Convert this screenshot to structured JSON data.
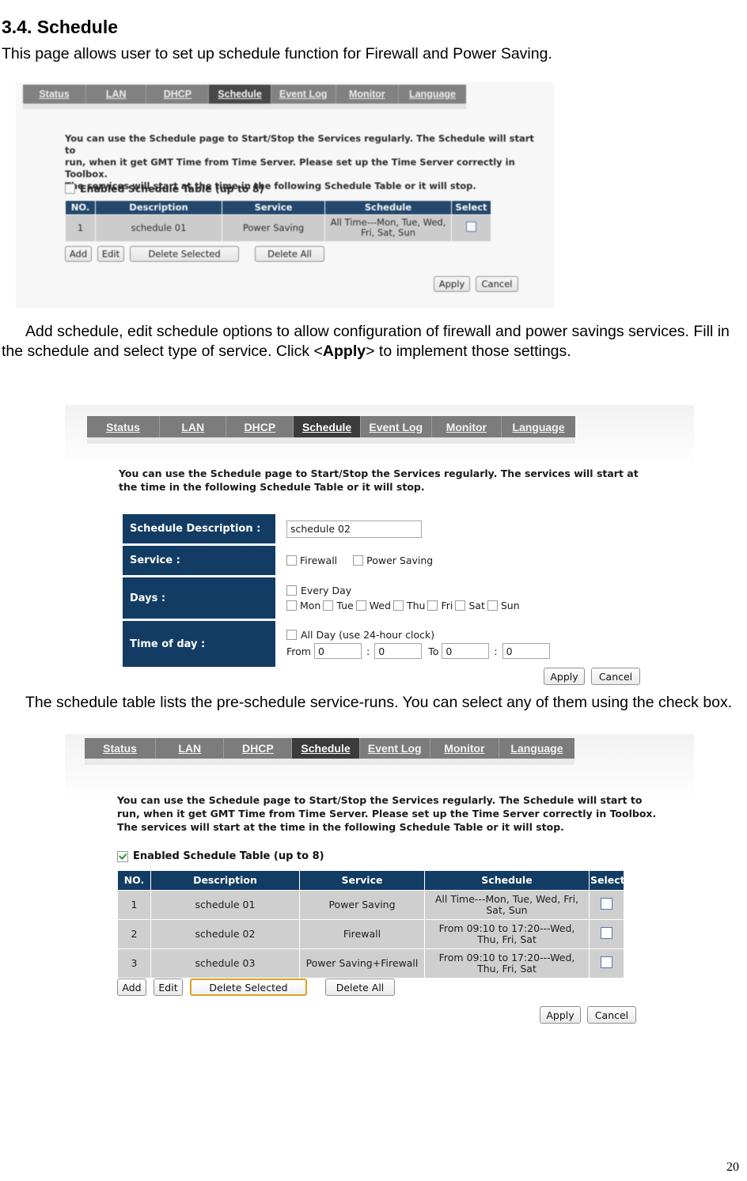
{
  "document": {
    "heading": "3.4. Schedule",
    "intro": "This page allows user to set up schedule function for Firewall and Power Saving.",
    "para2_a": "Add schedule, edit schedule options to allow configuration of firewall and power savings services. Fill in the schedule and select type of service. Click <",
    "para2_bold": "Apply",
    "para2_b": "> to implement those settings.",
    "para3": "The schedule table lists the pre-schedule service-runs. You can select any of them using the check box.",
    "page_number": "20"
  },
  "colors": {
    "header_navy": "#123c63",
    "tab_gray": "#7c7c7c",
    "tab_active": "#3c3c3c",
    "row_gray": "#cfcfcf",
    "highlight_orange": "#e0a021"
  },
  "tabs": [
    {
      "label": "Status",
      "active": false
    },
    {
      "label": "LAN",
      "active": false
    },
    {
      "label": "DHCP",
      "active": false
    },
    {
      "label": "Schedule",
      "active": true
    },
    {
      "label": "Event Log",
      "active": false
    },
    {
      "label": "Monitor",
      "active": false
    },
    {
      "label": "Language",
      "active": false
    }
  ],
  "screenshot1": {
    "description_lines": [
      "You can use the Schedule page to Start/Stop the Services regularly. The Schedule will start to",
      "run, when it get GMT Time from Time Server. Please set up the Time Server correctly in Toolbox.",
      "The services will start at the time in the following Schedule Table or it will stop."
    ],
    "enabled_label": "Enabled Schedule Table (up to 8)",
    "enabled_checked": false,
    "table": {
      "headers": [
        "NO.",
        "Description",
        "Service",
        "Schedule",
        "Select"
      ],
      "rows": [
        {
          "no": "1",
          "description": "schedule 01",
          "service": "Power Saving",
          "schedule": "All Time---Mon, Tue, Wed, Fri, Sat, Sun",
          "selected": false
        }
      ]
    },
    "buttons": [
      "Add",
      "Edit",
      "Delete Selected",
      "Delete All"
    ],
    "apply_label": "Apply",
    "cancel_label": "Cancel"
  },
  "screenshot2": {
    "description_lines": [
      "You can use the Schedule page to Start/Stop the Services regularly. The services will start at",
      "the time in the following Schedule Table or it will stop."
    ],
    "form": {
      "description_label": "Schedule Description :",
      "description_value": "schedule 02",
      "service_label": "Service :",
      "service_options": [
        "Firewall",
        "Power Saving"
      ],
      "days_label": "Days :",
      "every_day_label": "Every Day",
      "days": [
        "Mon",
        "Tue",
        "Wed",
        "Thu",
        "Fri",
        "Sat",
        "Sun"
      ],
      "time_label": "Time of day :",
      "all_day_label": "All Day (use 24-hour clock)",
      "from_label": "From",
      "to_label": "To",
      "from_hour": "0",
      "from_minute": "0",
      "to_hour": "0",
      "to_minute": "0",
      "colon": ":"
    },
    "apply_label": "Apply",
    "cancel_label": "Cancel"
  },
  "screenshot3": {
    "description_lines": [
      "You can use the Schedule page to Start/Stop the Services regularly. The Schedule will start to",
      "run, when it get GMT Time from Time Server. Please set up the Time Server correctly in Toolbox.",
      "The services will start at the time in the following Schedule Table or it will stop."
    ],
    "enabled_label": "Enabled Schedule Table (up to 8)",
    "enabled_checked": true,
    "table": {
      "headers": [
        "NO.",
        "Description",
        "Service",
        "Schedule",
        "Select"
      ],
      "rows": [
        {
          "no": "1",
          "description": "schedule 01",
          "service": "Power Saving",
          "schedule": "All Time---Mon, Tue, Wed, Fri, Sat, Sun",
          "selected": false
        },
        {
          "no": "2",
          "description": "schedule 02",
          "service": "Firewall",
          "schedule": "From 09:10 to 17:20---Wed, Thu, Fri, Sat",
          "selected": false
        },
        {
          "no": "3",
          "description": "schedule 03",
          "service": "Power Saving+Firewall",
          "schedule": "From 09:10 to 17:20---Wed, Thu, Fri, Sat",
          "selected": false
        }
      ]
    },
    "buttons": [
      "Add",
      "Edit",
      "Delete Selected",
      "Delete All"
    ],
    "highlighted_button": "Delete Selected",
    "apply_label": "Apply",
    "cancel_label": "Cancel"
  }
}
